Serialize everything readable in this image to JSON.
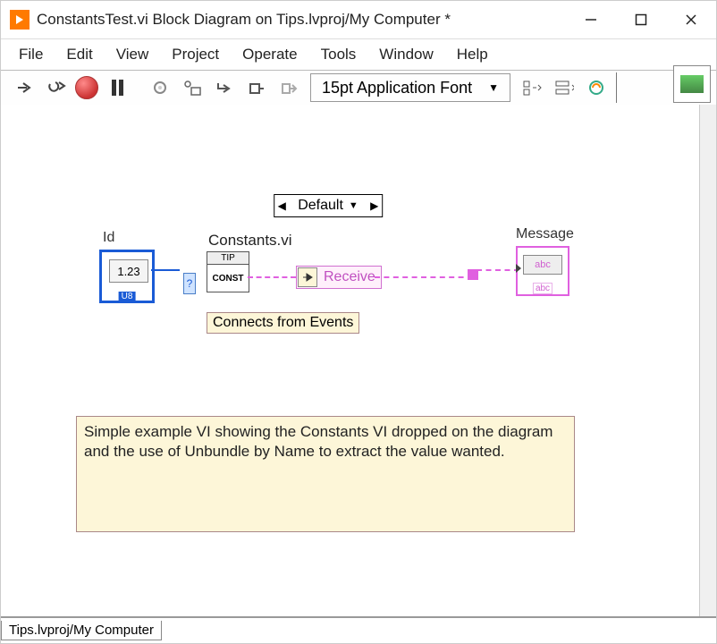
{
  "window": {
    "title": "ConstantsTest.vi Block Diagram on Tips.lvproj/My Computer *"
  },
  "menu": {
    "file": "File",
    "edit": "Edit",
    "view": "View",
    "project": "Project",
    "operate": "Operate",
    "tools": "Tools",
    "window": "Window",
    "help": "Help"
  },
  "toolbar": {
    "font_label": "15pt Application Font"
  },
  "diagram": {
    "id_label": "Id",
    "id_value": "1.23",
    "id_type": "U8",
    "case_selector": "Default",
    "q_node": "?",
    "constants_vi_label": "Constants.vi",
    "constants_tip": "TIP",
    "constants_const": "CONST",
    "unbundle_item": "Receive",
    "connects_comment": "Connects from Events",
    "message_label": "Message",
    "message_glyph": "abc",
    "message_type": "abc",
    "big_comment": "Simple example VI showing the Constants VI dropped on the diagram and the use of Unbundle by Name to extract the value wanted."
  },
  "status": {
    "path": "Tips.lvproj/My Computer"
  }
}
